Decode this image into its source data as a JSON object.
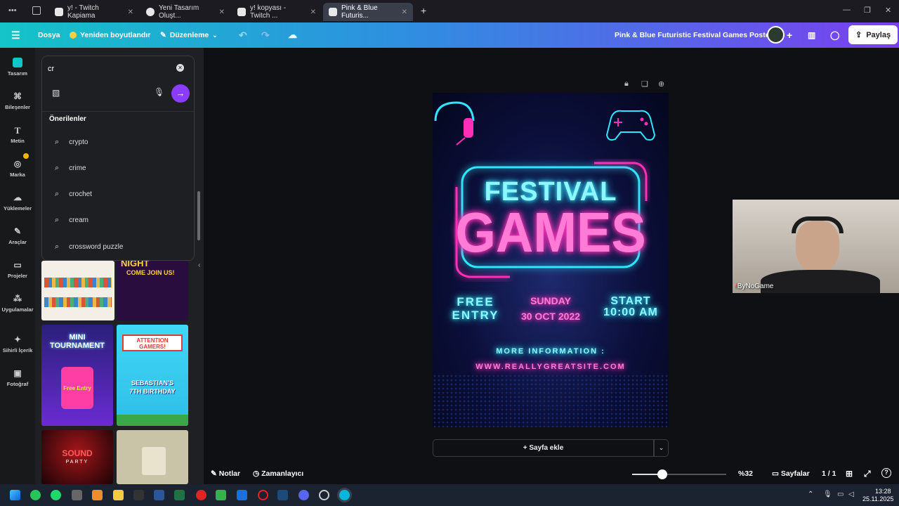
{
  "browser": {
    "tabs": [
      {
        "label": "y! - Twitch Kapiama",
        "active": false
      },
      {
        "label": "Yeni Tasarım Oluşt...",
        "active": false
      },
      {
        "label": "y! kopyası - Twitch ...",
        "active": false
      },
      {
        "label": "Pink & Blue Futuris...",
        "active": true
      }
    ],
    "new_tab_label": "+"
  },
  "header": {
    "file_label": "Dosya",
    "resize_label": "Yeniden boyutlandır",
    "edit_label": "Düzenleme",
    "doc_title": "Pink & Blue Futuristic Festival Games Poster",
    "share_label": "Paylaş"
  },
  "sidebar": {
    "items": [
      {
        "label": "Tasarım",
        "icon": "design-icon"
      },
      {
        "label": "Bileşenler",
        "icon": "elements-icon"
      },
      {
        "label": "Metin",
        "icon": "text-icon"
      },
      {
        "label": "Marka",
        "icon": "brand-icon"
      },
      {
        "label": "Yüklemeler",
        "icon": "upload-icon"
      },
      {
        "label": "Araçlar",
        "icon": "tools-icon"
      },
      {
        "label": "Projeler",
        "icon": "folder-icon"
      },
      {
        "label": "Uygulamalar",
        "icon": "apps-icon"
      },
      {
        "label": "Sihirli İçerik",
        "icon": "magic-icon"
      },
      {
        "label": "Fotoğraf",
        "icon": "photo-icon"
      }
    ]
  },
  "search": {
    "value": "cr",
    "suggestions_title": "Önerilenler",
    "suggestions": [
      "crypto",
      "crime",
      "crochet",
      "cream",
      "crossword puzzle"
    ]
  },
  "templates": {
    "mini_tournament": {
      "title": "MINI TOURNAMENT",
      "badge": "Free Entry"
    },
    "attention": {
      "title": "ATTENTION GAMERS!",
      "name": "SEBASTIAN'S",
      "event": "7TH BIRTHDAY"
    },
    "night": {
      "title": "NIGHT",
      "sub": "COME JOIN US!"
    },
    "sound": {
      "title": "SOUND",
      "sub": "PARTY"
    }
  },
  "poster": {
    "line1": "FESTIVAL",
    "line2": "GAMES",
    "free_entry": "FREE ENTRY",
    "day": "SUNDAY",
    "date": "30 OCT 2022",
    "start": "START",
    "time": "10:00 AM",
    "more_info": "MORE INFORMATION :",
    "site": "WWW.REALLYGREATSITE.COM"
  },
  "add_page_label": "+ Sayfa ekle",
  "webcam": {
    "overlay_name": "ByNoGame"
  },
  "bottombar": {
    "notes_label": "Notlar",
    "timer_label": "Zamanlayıcı",
    "zoom": "%32",
    "zoom_fraction": 0.32,
    "pages_label": "Sayfalar",
    "page_count": "1 / 1"
  },
  "taskbar": {
    "time": "13:28",
    "date": "25.11.2025"
  },
  "colors": {
    "header_start": "#13c4c8",
    "header_end": "#7b3ff0",
    "neon_cyan": "#2ee6ff",
    "neon_pink": "#ff2fb8",
    "search_go": "#8b3dff"
  }
}
